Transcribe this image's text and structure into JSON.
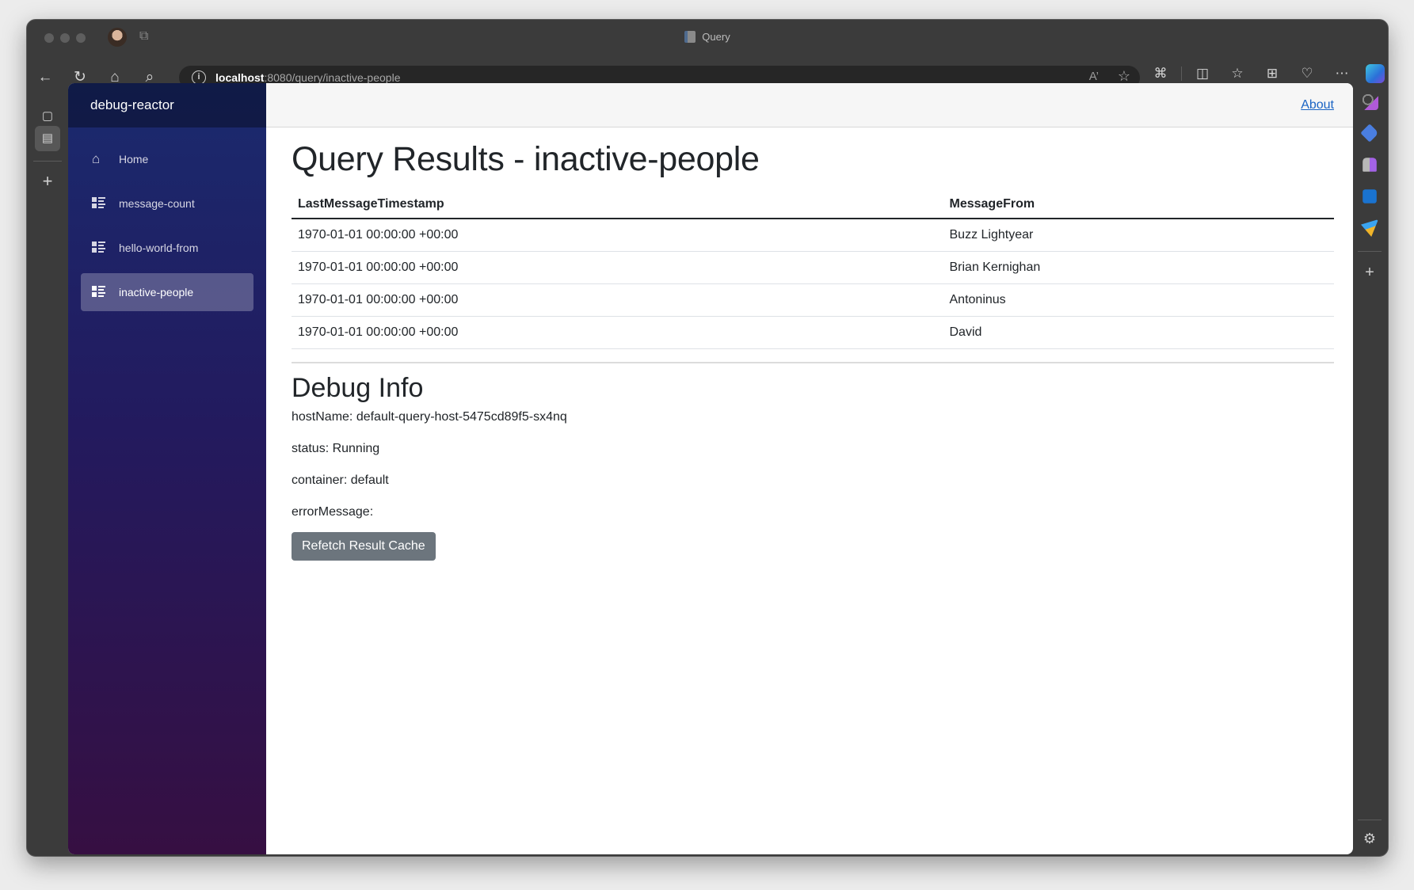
{
  "browser": {
    "tab_title": "Query",
    "url_host": "localhost",
    "url_path": ":8080/query/inactive-people",
    "toolbar_icons": [
      "back-icon",
      "refresh-icon",
      "home-icon",
      "search-icon"
    ],
    "address_icons": [
      "site-info-icon",
      "read-aloud-icon",
      "favorite-star-icon"
    ],
    "right_icons": [
      "extensions-icon",
      "split-screen-icon",
      "favorites-icon",
      "collections-icon",
      "browser-essentials-icon",
      "more-icon",
      "copilot-icon"
    ],
    "sidebar_icons": [
      "search-icon",
      "shopping-icon",
      "games-icon",
      "outlook-icon",
      "drop-icon",
      "add-icon",
      "settings-icon"
    ],
    "colors": {
      "chrome": "#3b3b3b",
      "address_bar": "#262626",
      "copilot": "#2b6fd8"
    }
  },
  "app": {
    "brand": "debug-reactor",
    "nav": [
      {
        "label": "Home",
        "icon": "home-icon",
        "active": false
      },
      {
        "label": "message-count",
        "icon": "list-icon",
        "active": false
      },
      {
        "label": "hello-world-from",
        "icon": "list-icon",
        "active": false
      },
      {
        "label": "inactive-people",
        "icon": "list-icon",
        "active": true
      }
    ],
    "topbar": {
      "about_label": "About"
    },
    "colors": {
      "sidebar_top": "#1a2a6e",
      "sidebar_bottom": "#360f42",
      "link": "#1a64c4",
      "button": "#6c757d",
      "text": "#212529"
    }
  },
  "page": {
    "title": "Query Results - inactive-people",
    "table": {
      "columns": [
        "LastMessageTimestamp",
        "MessageFrom"
      ],
      "rows": [
        [
          "1970-01-01 00:00:00 +00:00",
          "Buzz Lightyear"
        ],
        [
          "1970-01-01 00:00:00 +00:00",
          "Brian Kernighan"
        ],
        [
          "1970-01-01 00:00:00 +00:00",
          "Antoninus"
        ],
        [
          "1970-01-01 00:00:00 +00:00",
          "David"
        ]
      ]
    },
    "debug": {
      "title": "Debug Info",
      "hostName": "hostName: default-query-host-5475cd89f5-sx4nq",
      "status": "status: Running",
      "container": "container: default",
      "errorMessage": "errorMessage:",
      "refetch_label": "Refetch Result Cache"
    }
  }
}
